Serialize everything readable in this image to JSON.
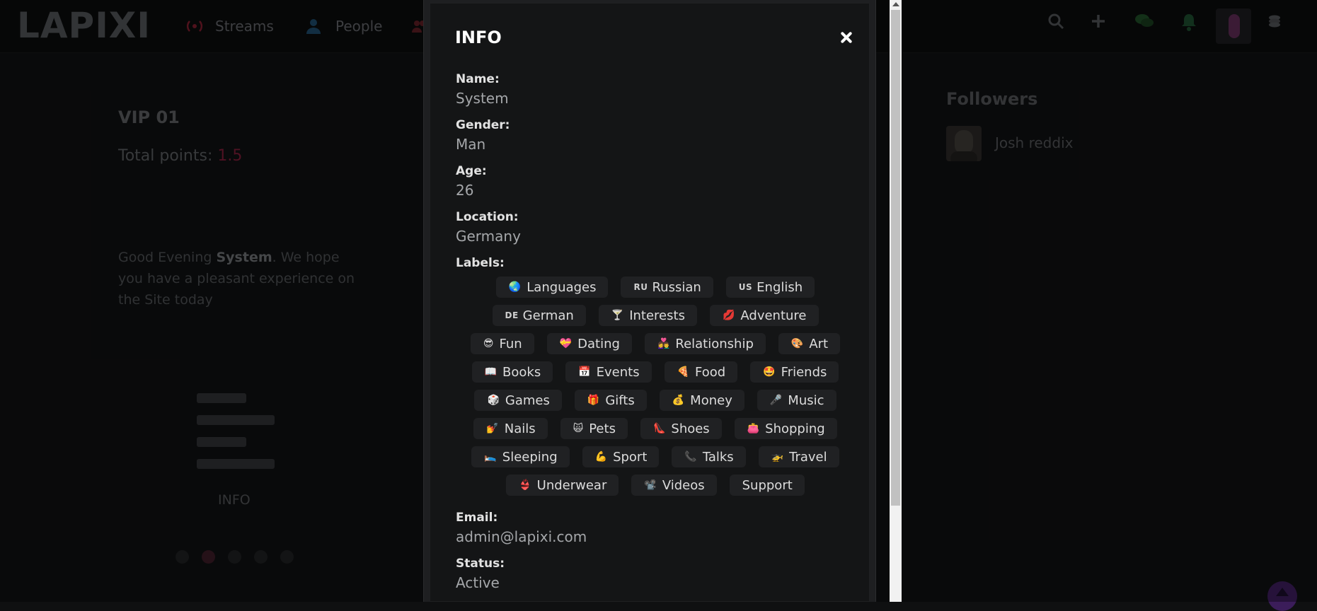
{
  "header": {
    "logo": "LAPIXI",
    "nav": [
      {
        "label": "Streams",
        "icon": "stream-icon"
      },
      {
        "label": "People",
        "icon": "person-icon"
      },
      {
        "label": "",
        "icon": "group-icon"
      }
    ],
    "actions": [
      "search-icon",
      "plus-icon",
      "chat-icon",
      "bell-icon",
      "profile-avatar",
      "coins-icon"
    ]
  },
  "profile": {
    "title": "VIP 01",
    "points_label": "Total points:",
    "points_value": "1.5",
    "greeting_pre": "Good Evening ",
    "greeting_name": "System",
    "greeting_post": ". We hope you have a pleasant experience on the Site today",
    "menu_label": "INFO",
    "carousel_pages": 5,
    "carousel_active": 2
  },
  "followers": {
    "title": "Followers",
    "items": [
      {
        "name": "Josh reddix"
      }
    ]
  },
  "modal": {
    "title": "INFO",
    "fields": {
      "name": {
        "label": "Name:",
        "value": "System"
      },
      "gender": {
        "label": "Gender:",
        "value": "Man"
      },
      "age": {
        "label": "Age:",
        "value": "26"
      },
      "location": {
        "label": "Location:",
        "value": "Germany"
      },
      "labels": {
        "label": "Labels:"
      },
      "email": {
        "label": "Email:",
        "value": "admin@lapixi.com"
      },
      "status": {
        "label": "Status:",
        "value": "Active"
      }
    },
    "labels": [
      {
        "icon": "🌏",
        "text": "Languages"
      },
      {
        "code": "RU",
        "text": "Russian"
      },
      {
        "code": "US",
        "text": "English"
      },
      {
        "code": "DE",
        "text": "German"
      },
      {
        "icon": "🍸",
        "text": "Interests"
      },
      {
        "icon": "💋",
        "text": "Adventure"
      },
      {
        "icon": "😎",
        "text": "Fun"
      },
      {
        "icon": "💝",
        "text": "Dating"
      },
      {
        "icon": "👩‍❤️‍👨",
        "text": "Relationship"
      },
      {
        "icon": "🎨",
        "text": "Art"
      },
      {
        "icon": "📖",
        "text": "Books"
      },
      {
        "icon": "📅",
        "text": "Events"
      },
      {
        "icon": "🍕",
        "text": "Food"
      },
      {
        "icon": "🤩",
        "text": "Friends"
      },
      {
        "icon": "🎲",
        "text": "Games"
      },
      {
        "icon": "🎁",
        "text": "Gifts"
      },
      {
        "icon": "💰",
        "text": "Money"
      },
      {
        "icon": "🎤",
        "text": "Music"
      },
      {
        "icon": "💅",
        "text": "Nails"
      },
      {
        "icon": "🙀",
        "text": "Pets"
      },
      {
        "icon": "👠",
        "text": "Shoes"
      },
      {
        "icon": "👛",
        "text": "Shopping"
      },
      {
        "icon": "🛌",
        "text": "Sleeping"
      },
      {
        "icon": "💪",
        "text": "Sport"
      },
      {
        "icon": "📞",
        "text": "Talks"
      },
      {
        "icon": "🚁",
        "text": "Travel"
      },
      {
        "icon": "👙",
        "text": "Underwear"
      },
      {
        "icon": "📽️",
        "text": "Videos"
      },
      {
        "text": "Support"
      }
    ]
  },
  "colors": {
    "accent": "#b0163f",
    "background": "#0f1011",
    "modal_bg": "#141516",
    "chip_bg": "#202123"
  }
}
